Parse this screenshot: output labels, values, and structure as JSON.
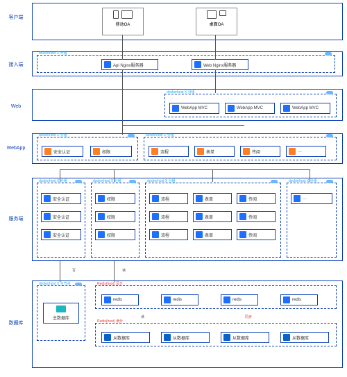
{
  "labels": {
    "l1": "客户端",
    "l2": "接入端",
    "l3": "Web",
    "l4": "WebApp",
    "l5": "服务端",
    "l6": "数据库"
  },
  "clients": {
    "mobile": "移动OA",
    "desktop": "桌面OA"
  },
  "cluster_tag": "dockerhost X 分组",
  "access": {
    "api": "Api Nginx服务器",
    "web": "Web Nginx服务器"
  },
  "web": {
    "mvc": "WebApp MVC"
  },
  "webapp_left": {
    "i0": "安全认证",
    "i1": "权限"
  },
  "webapp_right": {
    "i0": "流程",
    "i1": "表单",
    "i2": "传阅",
    "i3": "…"
  },
  "svc": {
    "s1": "安全认证",
    "s2": "权限",
    "s3": "流程",
    "s4": "表单",
    "s5": "传阅"
  },
  "svc_right_tag": "dockerhost X 分组",
  "redis": {
    "tag": "Redis(host) 写分",
    "tag2": "Redis(host) 读分",
    "item": "redis"
  },
  "db": {
    "master_tag": "dockerhost X 主节点",
    "master": "主数据库",
    "slave": "从数据库"
  },
  "flags": {
    "write": "写",
    "read": "读",
    "same": "同步"
  }
}
